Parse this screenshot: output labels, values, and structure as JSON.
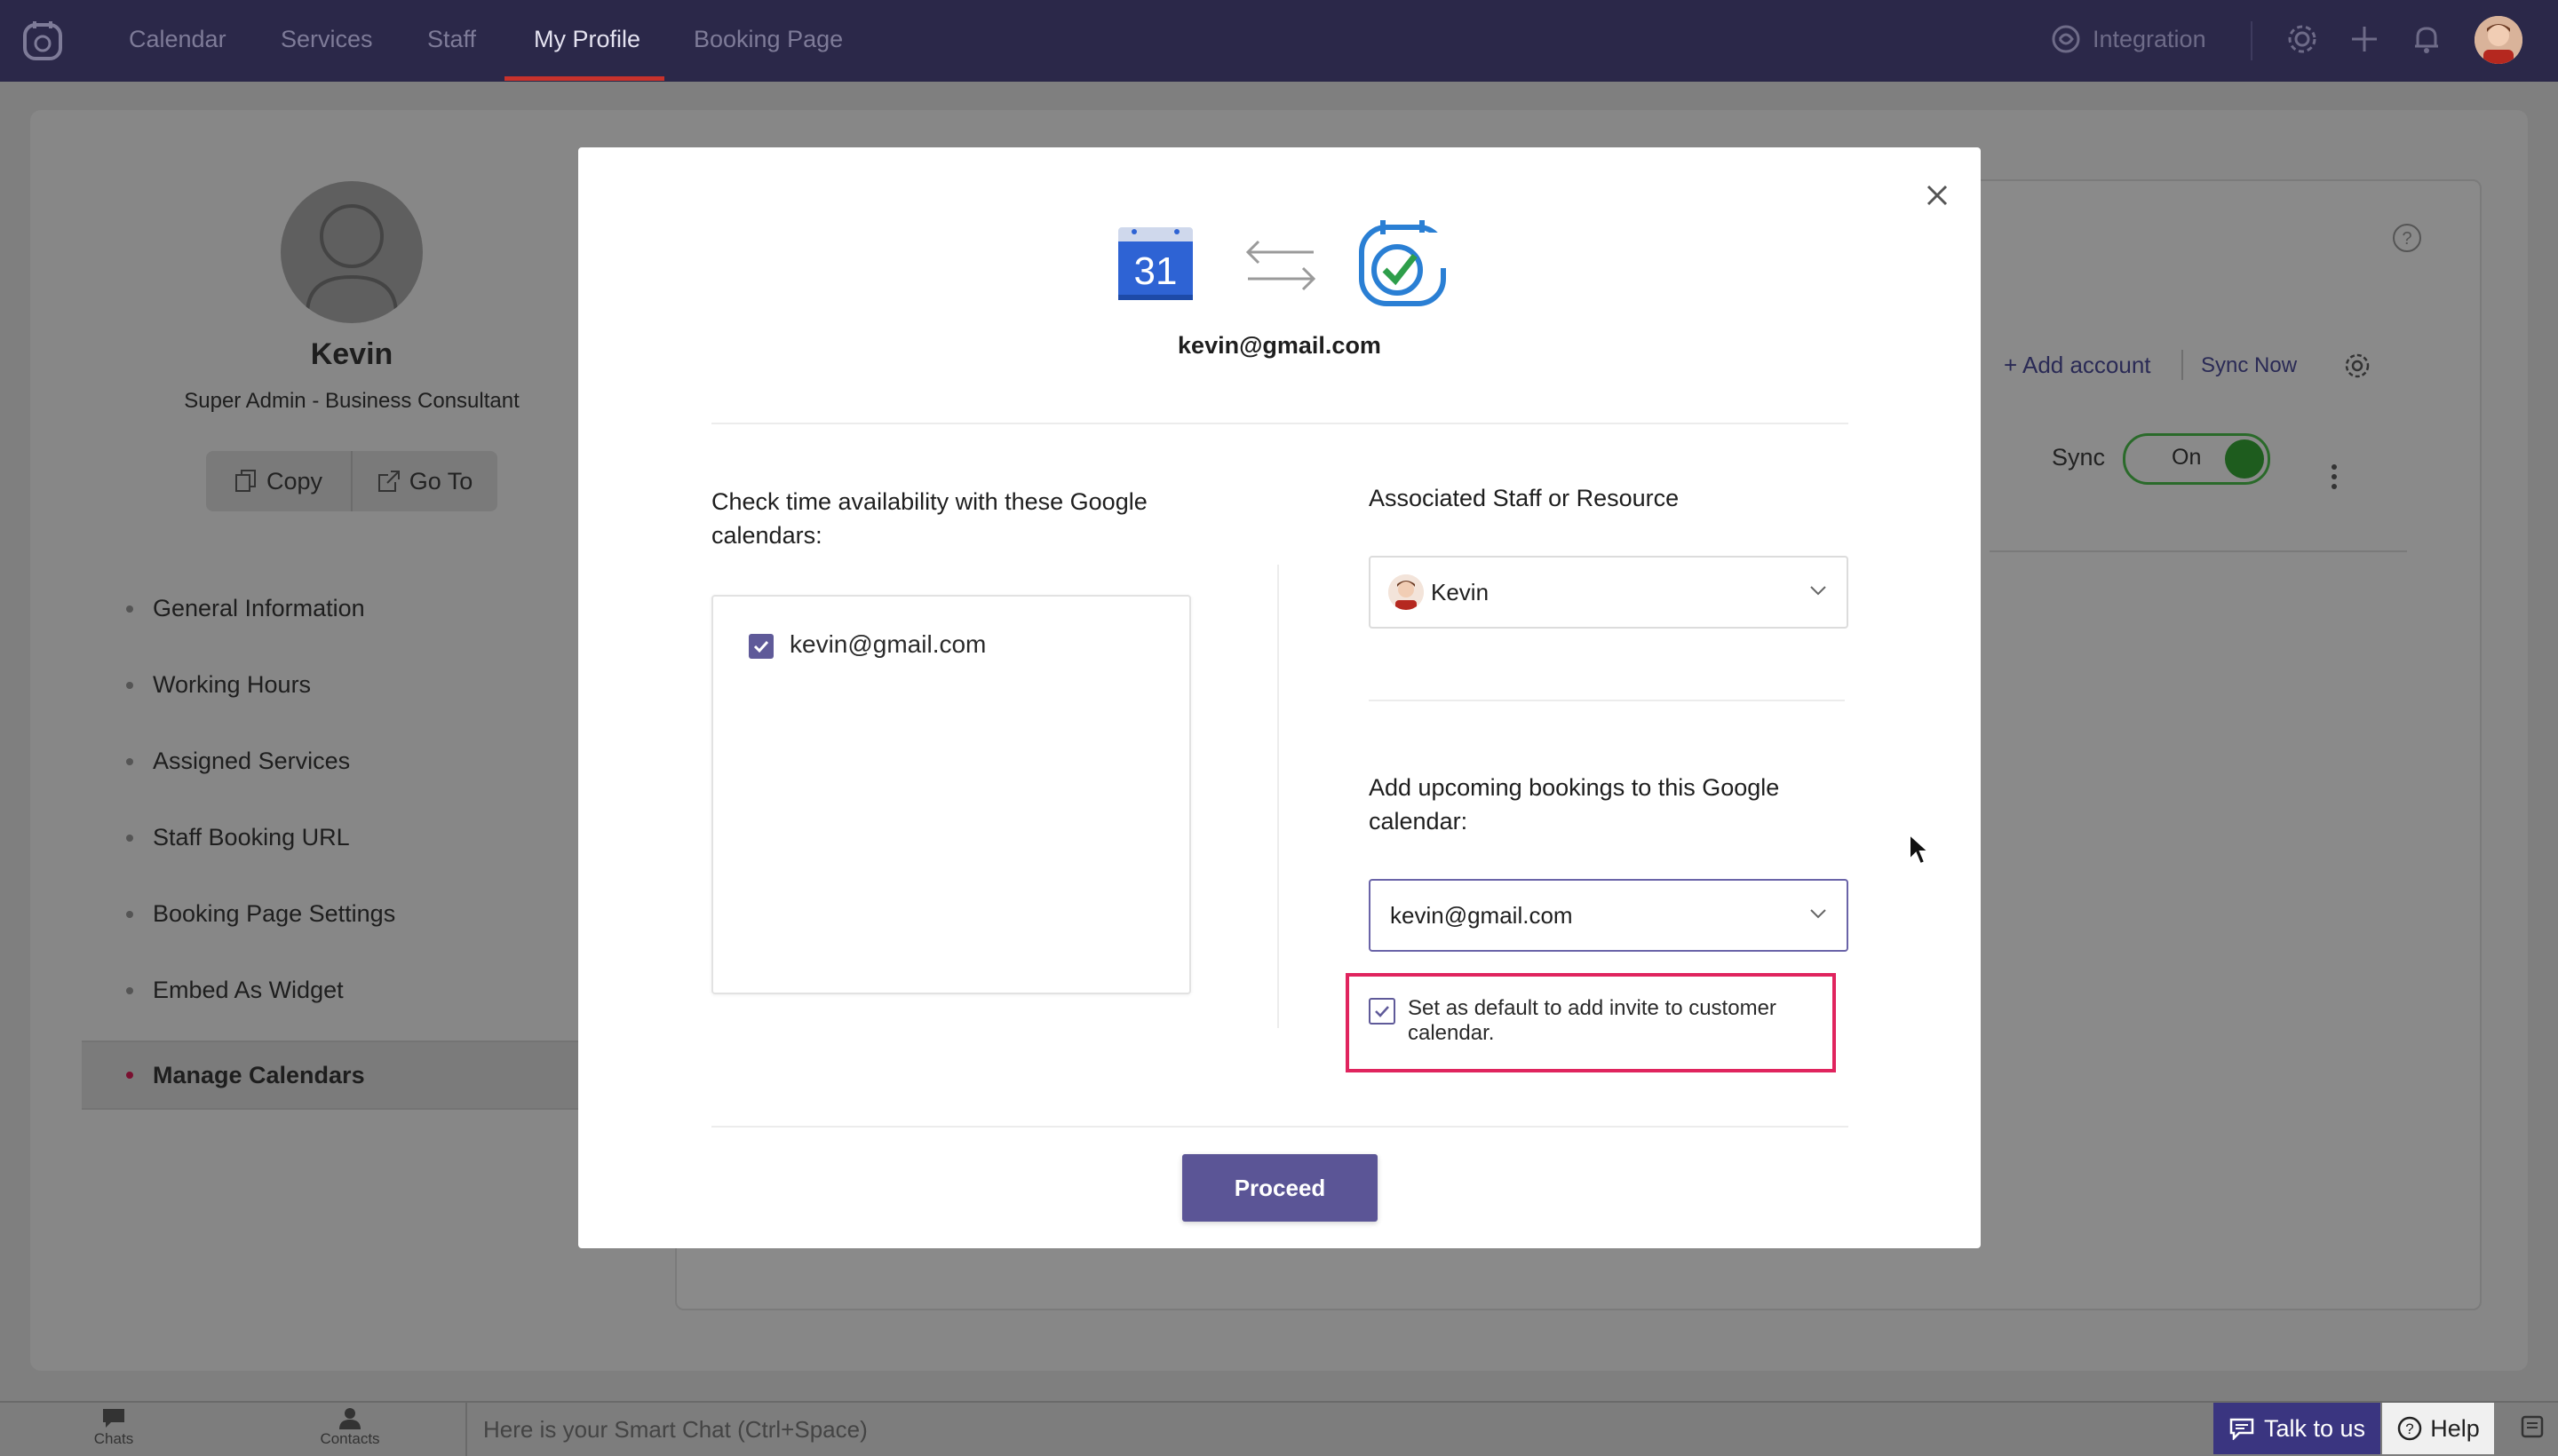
{
  "topnav": {
    "items": [
      {
        "label": "Calendar"
      },
      {
        "label": "Services"
      },
      {
        "label": "Staff"
      },
      {
        "label": "My Profile",
        "active": true
      },
      {
        "label": "Booking Page"
      }
    ],
    "integration_label": "Integration",
    "accent_color": "#c8322c"
  },
  "profile": {
    "name": "Kevin",
    "role": "Super Admin - Business Consultant",
    "copy_label": "Copy",
    "goto_label": "Go To"
  },
  "sidebar": {
    "items": [
      {
        "label": "General Information"
      },
      {
        "label": "Working Hours"
      },
      {
        "label": "Assigned Services"
      },
      {
        "label": "Staff Booking URL"
      },
      {
        "label": "Booking Page Settings"
      },
      {
        "label": "Embed As Widget"
      },
      {
        "label": "Manage Calendars",
        "active": true
      }
    ]
  },
  "calendar_panel": {
    "add_account_label": "+ Add account",
    "sync_now_label": "Sync Now",
    "sync_label": "Sync",
    "toggle_label": "On"
  },
  "modal": {
    "account_email": "kevin@gmail.com",
    "gcal_day": "31",
    "check_availability_label": "Check time availability with these Google calendars:",
    "calendars": [
      {
        "label": "kevin@gmail.com",
        "checked": true
      }
    ],
    "associated_label": "Associated Staff or Resource",
    "associated_value": "Kevin",
    "add_bookings_label": "Add upcoming bookings to this Google calendar:",
    "bookings_calendar_value": "kevin@gmail.com",
    "default_invite_label": "Set as default to add invite to customer calendar.",
    "default_invite_checked": true,
    "proceed_label": "Proceed",
    "highlight_color": "#e0245e",
    "primary_color": "#5b5596"
  },
  "bottombar": {
    "chats_label": "Chats",
    "contacts_label": "Contacts",
    "smartchat_placeholder": "Here is your Smart Chat (Ctrl+Space)",
    "talk_label": "Talk to us",
    "help_label": "Help"
  }
}
